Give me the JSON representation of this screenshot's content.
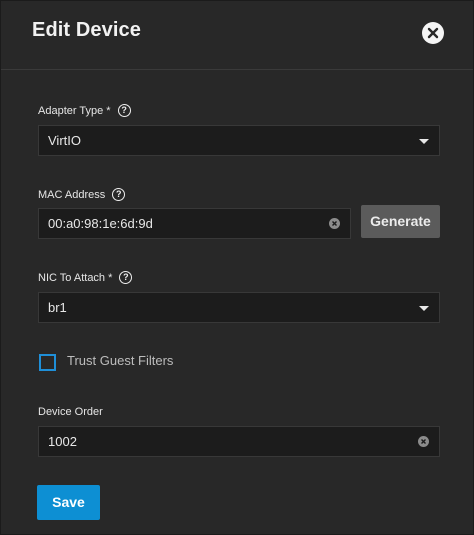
{
  "dialog": {
    "title": "Edit Device",
    "close_icon": "close-icon"
  },
  "adapter_type": {
    "label": "Adapter Type *",
    "help": "?",
    "value": "VirtIO"
  },
  "mac_address": {
    "label": "MAC Address",
    "help": "?",
    "value": "00:a0:98:1e:6d:9d",
    "generate_label": "Generate"
  },
  "nic_to_attach": {
    "label": "NIC To Attach *",
    "help": "?",
    "value": "br1"
  },
  "trust_guest_filters": {
    "label": "Trust Guest Filters",
    "checked": false
  },
  "device_order": {
    "label": "Device Order",
    "value": "1002"
  },
  "actions": {
    "save_label": "Save"
  },
  "colors": {
    "background": "#282828",
    "accent": "#0d8fd3",
    "secondary_button": "#5b5b5b"
  }
}
